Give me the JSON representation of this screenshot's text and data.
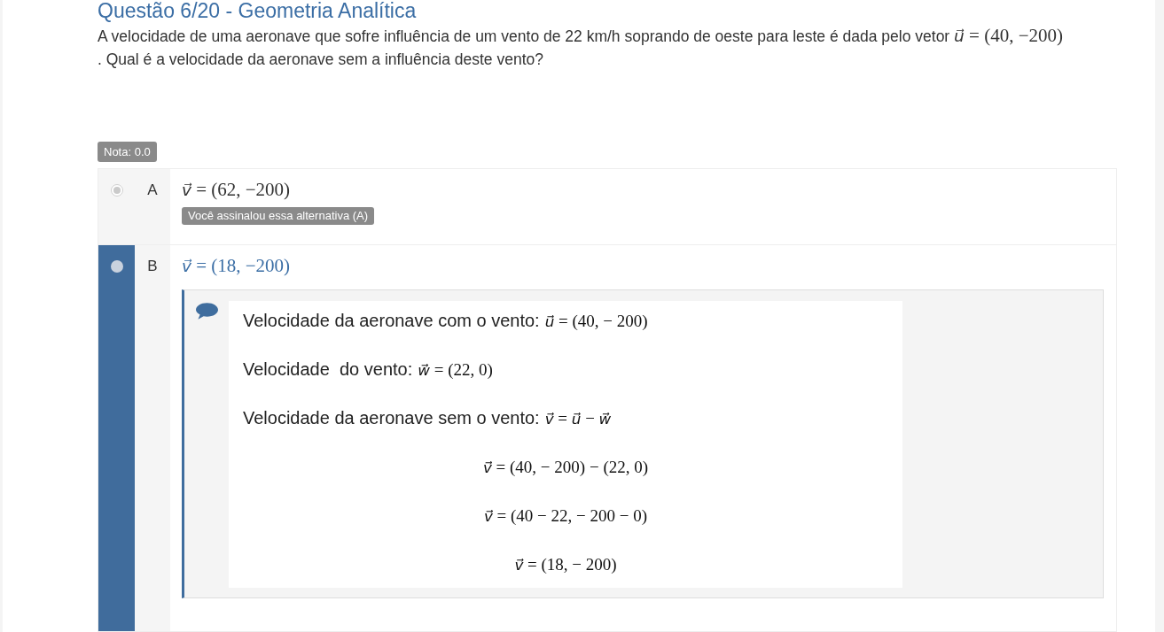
{
  "question": {
    "title": "Questão 6/20 - Geometria Analítica",
    "text": "A velocidade de uma aeronave que sofre influência de um vento de 22 km/h soprando de oeste para leste é dada pelo vetor",
    "math": "*u⃗* = (40, −200)",
    "text_after": ". Qual é a velocidade da aeronave sem a influência deste vento?"
  },
  "grade": "Nota: 0.0",
  "options": [
    {
      "letter": "A",
      "answer": "*v⃗* = (62, −200)",
      "selected": true,
      "correct": false,
      "badge": "Você assinalou essa alternativa (A)"
    },
    {
      "letter": "B",
      "answer": "*v⃗* = (18, −200)",
      "selected": false,
      "correct": true,
      "feedback": [
        {
          "kind": "labeled",
          "label": "Velocidade da aeronave com o vento:",
          "math": "*u⃗* = (40, − 200)"
        },
        {
          "kind": "labeled",
          "label": "Velocidade  do vento:",
          "math": "*w⃗* = (22, 0)"
        },
        {
          "kind": "labeled",
          "label": "Velocidade da aeronave sem o vento:",
          "math": "*v⃗* = *u⃗* − *w⃗*"
        },
        {
          "kind": "equation",
          "math": "*v⃗* = (40, − 200) − (22, 0)"
        },
        {
          "kind": "equation",
          "math": "*v⃗* = (40 − 22, − 200 − 0)"
        },
        {
          "kind": "equation",
          "math": "*v⃗* = (18, − 200)"
        }
      ]
    }
  ]
}
